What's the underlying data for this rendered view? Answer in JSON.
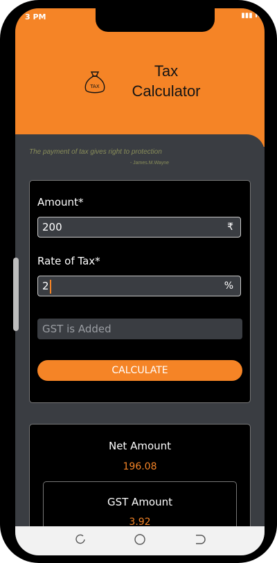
{
  "status_bar": {
    "time": "3 PM",
    "right_text": "R"
  },
  "header": {
    "icon_text": "TAX",
    "title_line1": "Tax",
    "title_line2": "Calculator"
  },
  "quote": {
    "text": "The payment of tax gives right to protection",
    "author": "- James.M.Wayne"
  },
  "form": {
    "amount_label": "Amount*",
    "amount_value": "200",
    "amount_unit": "₹",
    "rate_label": "Rate of Tax*",
    "rate_value": "2",
    "rate_unit": "%",
    "gst_option": "GST is Added",
    "calculate_label": "CALCULATE"
  },
  "results": {
    "net_title": "Net Amount",
    "net_value": "196.08",
    "gst_title": "GST Amount",
    "gst_value": "3.92"
  },
  "colors": {
    "accent": "#f58426",
    "background": "#3a3d42",
    "card": "#000000"
  }
}
